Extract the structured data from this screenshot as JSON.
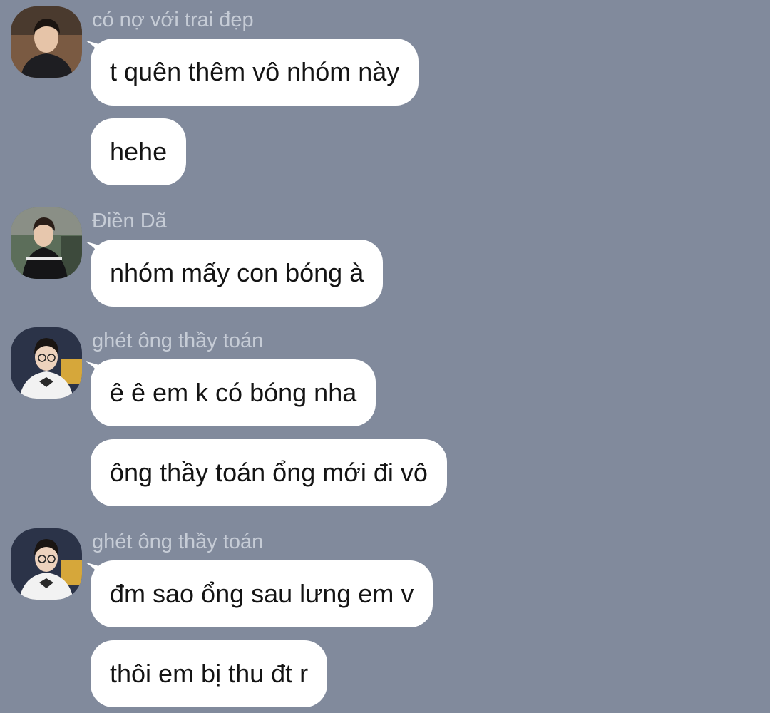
{
  "messages": [
    {
      "sender": "có nợ với trai đẹp",
      "avatar": "user-avatar-photo",
      "bubbles": [
        "t quên thêm vô nhóm này",
        "hehe"
      ]
    },
    {
      "sender": "Điền Dã",
      "avatar": "user-avatar-photo",
      "bubbles": [
        "nhóm mấy con bóng à"
      ]
    },
    {
      "sender": "ghét ông thầy toán",
      "avatar": "user-avatar-photo",
      "bubbles": [
        "ê ê em k có bóng nha",
        "ông thầy toán ổng mới đi vô"
      ]
    },
    {
      "sender": "ghét ông thầy toán",
      "avatar": "user-avatar-photo",
      "bubbles": [
        "đm sao ổng sau lưng em v",
        "thôi em bị thu đt r"
      ]
    }
  ],
  "colors": {
    "background": "#818a9c",
    "bubble": "#ffffff",
    "sender_name": "#c6ccd6",
    "message_text": "#141414"
  }
}
